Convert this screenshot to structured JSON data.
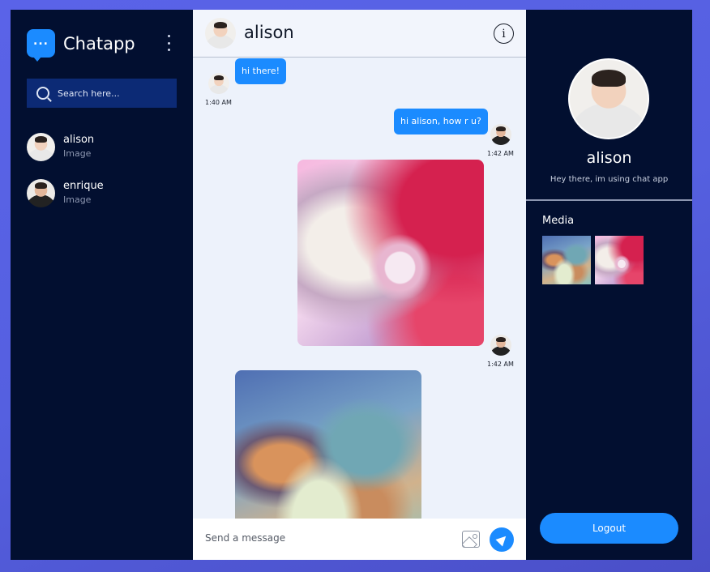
{
  "sidebar": {
    "app_name": "Chatapp",
    "brand_icon": "chat-bubble-icon",
    "menu_icon": "kebab-menu-icon",
    "search": {
      "placeholder": "Search here...",
      "value": ""
    },
    "contacts": [
      {
        "name": "alison",
        "preview": "Image"
      },
      {
        "name": "enrique",
        "preview": "Image"
      }
    ]
  },
  "chat": {
    "title": "alison",
    "info_icon": "info-icon",
    "messages": [
      {
        "sender": "alison",
        "type": "text",
        "text": "hi there!",
        "time": "1:40 AM"
      },
      {
        "sender": "me",
        "type": "text",
        "text": "hi alison, how r u?",
        "time": "1:42 AM"
      },
      {
        "sender": "me",
        "type": "image",
        "time": "1:42 AM"
      },
      {
        "sender": "alison",
        "type": "image"
      }
    ],
    "composer": {
      "placeholder": "Send a message",
      "value": ""
    }
  },
  "profile": {
    "name": "alison",
    "status": "Hey there, im using chat app",
    "media_title": "Media",
    "logout_label": "Logout"
  },
  "colors": {
    "accent": "#1b8bff",
    "sidebar_bg": "#020f30",
    "search_bg": "#0c2a75",
    "chat_bg": "#edf2fb",
    "page_bg": "#5a63e8"
  }
}
